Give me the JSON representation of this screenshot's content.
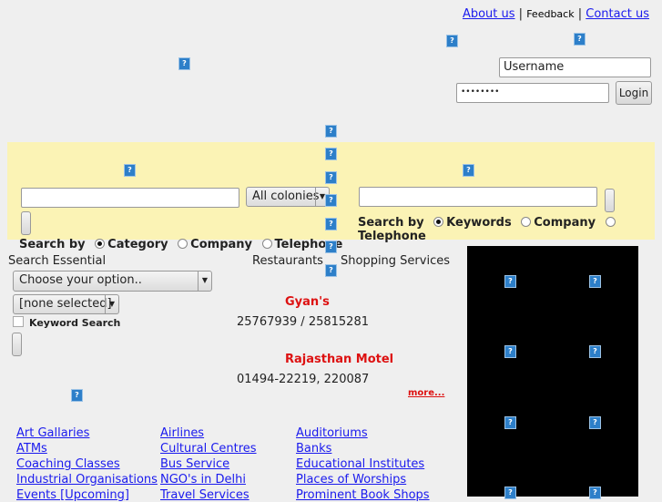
{
  "top_links": {
    "about": "About us",
    "sep": "|",
    "feedback": "Feedback",
    "contact": "Contact us"
  },
  "login": {
    "username": "Username",
    "password": "••••••••",
    "button": "Login"
  },
  "search_left": {
    "colonies": "All colonies",
    "search_by": "Search by",
    "options": [
      "Category",
      "Company",
      "Telephone"
    ],
    "selected": "Category"
  },
  "search_right": {
    "search_by": "Search by",
    "options": [
      "Keywords",
      "Company",
      "Telephone"
    ],
    "selected": "Keywords"
  },
  "essential": {
    "title": "Search Essential",
    "choose": "Choose your option..",
    "none": "[none selected]",
    "keyword_search": "Keyword Search"
  },
  "tabs": [
    "Restaurants",
    "Shopping Services"
  ],
  "listings": [
    {
      "name": "Gyan's",
      "phone": "25767939 / 25815281"
    },
    {
      "name": "Rajasthan Motel",
      "phone": "01494-22219, 220087"
    }
  ],
  "more": "more...",
  "categories": [
    [
      "Art Gallaries",
      "ATMs",
      "Coaching Classes",
      "Industrial Organisations",
      "Events [Upcoming]"
    ],
    [
      "Airlines",
      "Cultural Centres",
      "Bus Service",
      "NGO's in Delhi",
      "Travel Services"
    ],
    [
      "Auditoriums",
      "Banks",
      "Educational Institutes",
      "Places of Worships",
      "Prominent Book Shops"
    ]
  ],
  "colors": {
    "yellow_band": "#fbf3b5",
    "link": "#1a1aee",
    "listing": "#dd1111"
  }
}
